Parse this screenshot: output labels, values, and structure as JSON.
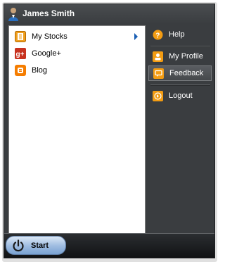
{
  "user": {
    "name": "James Smith"
  },
  "programs": [
    {
      "label": "My Stocks",
      "icon": "stocks-icon",
      "has_submenu": true
    },
    {
      "label": "Google+",
      "icon": "google-plus-icon"
    },
    {
      "label": "Blog",
      "icon": "blog-icon"
    }
  ],
  "right_menu": {
    "help": "Help",
    "profile": "My Profile",
    "feedback": "Feedback",
    "logout": "Logout"
  },
  "start": {
    "label": "Start"
  },
  "colors": {
    "menu_bg": "#3a3d40",
    "accent_orange": "#f39c12",
    "start_blue": "#9dbbe0"
  }
}
